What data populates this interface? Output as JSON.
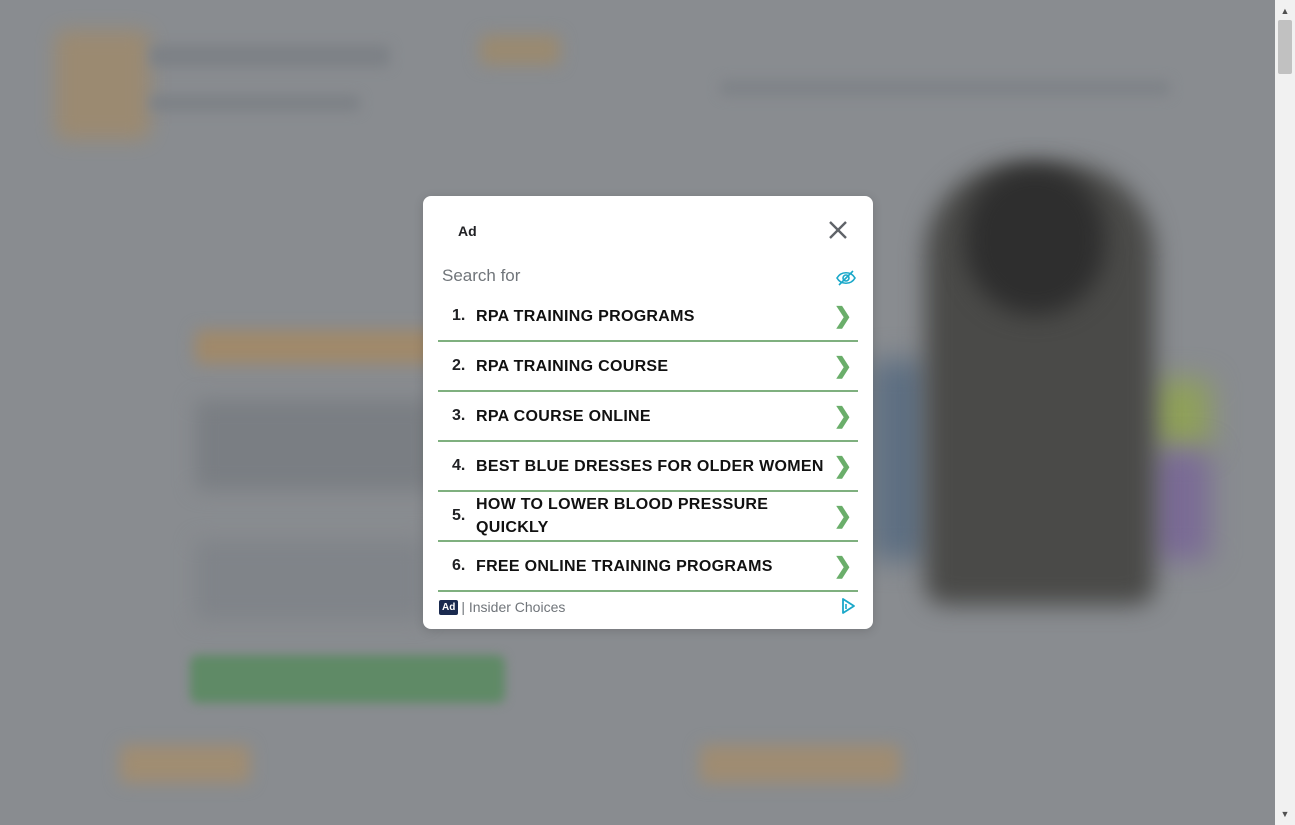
{
  "ad": {
    "label": "Ad",
    "search_label": "Search for",
    "items": [
      {
        "num": "1.",
        "label": "RPA TRAINING PROGRAMS"
      },
      {
        "num": "2.",
        "label": "RPA TRAINING COURSE"
      },
      {
        "num": "3.",
        "label": "RPA COURSE ONLINE"
      },
      {
        "num": "4.",
        "label": "BEST BLUE DRESSES FOR OLDER WOMEN"
      },
      {
        "num": "5.",
        "label": "HOW TO LOWER BLOOD PRESSURE QUICKLY"
      },
      {
        "num": "6.",
        "label": "FREE ONLINE TRAINING PROGRAMS"
      }
    ],
    "footer_badge": "Ad",
    "footer_text": "| Insider Choices",
    "colors": {
      "divider": "#7fb07f",
      "chevron": "#6aae6a",
      "eye": "#1aa8c9"
    }
  },
  "icons": {
    "close": "close-icon",
    "hide": "eye-slash-icon",
    "chevron": "chevron-right-icon",
    "adchoices": "adchoices-icon"
  }
}
